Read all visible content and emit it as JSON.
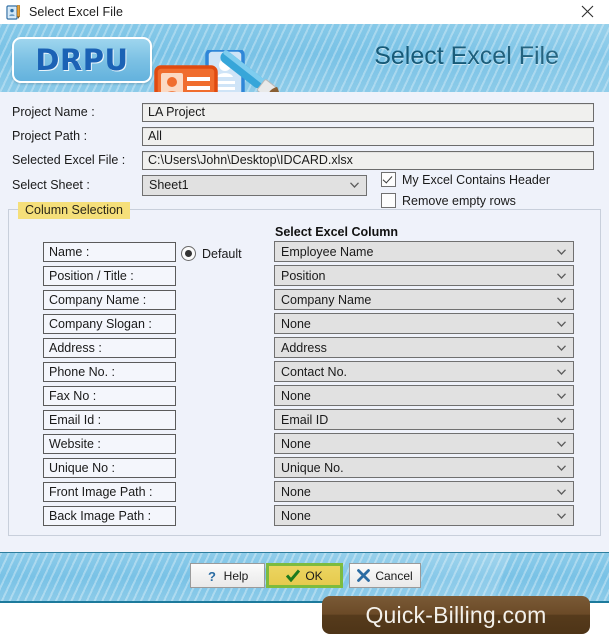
{
  "titlebar": {
    "title": "Select Excel File",
    "icon": "id-card-pen-icon",
    "close_label": "✕"
  },
  "banner": {
    "logo_text": "DRPU",
    "title": "Select Excel File",
    "art": "id-cards-brush-illustration"
  },
  "form": {
    "fields": [
      {
        "label": "Project Name :",
        "value": "LA Project"
      },
      {
        "label": "Project Path :",
        "value": "All"
      },
      {
        "label": "Selected Excel File :",
        "value": "C:\\Users\\John\\Desktop\\IDCARD.xlsx"
      }
    ],
    "sheet": {
      "label": "Select Sheet :",
      "value": "Sheet1"
    },
    "checkboxes": [
      {
        "label": "My Excel Contains Header",
        "checked": true
      },
      {
        "label": "Remove empty rows",
        "checked": false
      }
    ]
  },
  "column_selection": {
    "legend": "Column Selection",
    "excel_column_header": "Select Excel Column",
    "default_radio_label": "Default",
    "rows": [
      {
        "field": "Name :",
        "excel_column": "Employee Name"
      },
      {
        "field": "Position / Title :",
        "excel_column": "Position"
      },
      {
        "field": "Company Name :",
        "excel_column": "Company Name"
      },
      {
        "field": "Company Slogan :",
        "excel_column": "None"
      },
      {
        "field": "Address :",
        "excel_column": "Address"
      },
      {
        "field": "Phone No. :",
        "excel_column": "Contact No."
      },
      {
        "field": "Fax No :",
        "excel_column": "None"
      },
      {
        "field": "Email Id :",
        "excel_column": "Email ID"
      },
      {
        "field": "Website :",
        "excel_column": "None"
      },
      {
        "field": "Unique No :",
        "excel_column": "Unique No."
      },
      {
        "field": "Front Image Path :",
        "excel_column": "None"
      },
      {
        "field": "Back Image Path :",
        "excel_column": "None"
      }
    ]
  },
  "footer": {
    "buttons": [
      {
        "label": "Help",
        "icon": "question-mark-icon",
        "focused": false
      },
      {
        "label": "OK",
        "icon": "check-mark-icon",
        "focused": true
      },
      {
        "label": "Cancel",
        "icon": "x-mark-icon",
        "focused": false
      }
    ]
  },
  "watermark": {
    "text": "Quick-Billing.com"
  },
  "colors": {
    "banner_blue": "#79c2e6",
    "logo_blue": "#1b62b5",
    "legend_yellow": "#f5df7a",
    "focus_green": "#7dbb3e",
    "focus_yellow": "#e6ca4e",
    "panel_bg": "#eff2fa",
    "watermark_brown": "#563b1c"
  }
}
